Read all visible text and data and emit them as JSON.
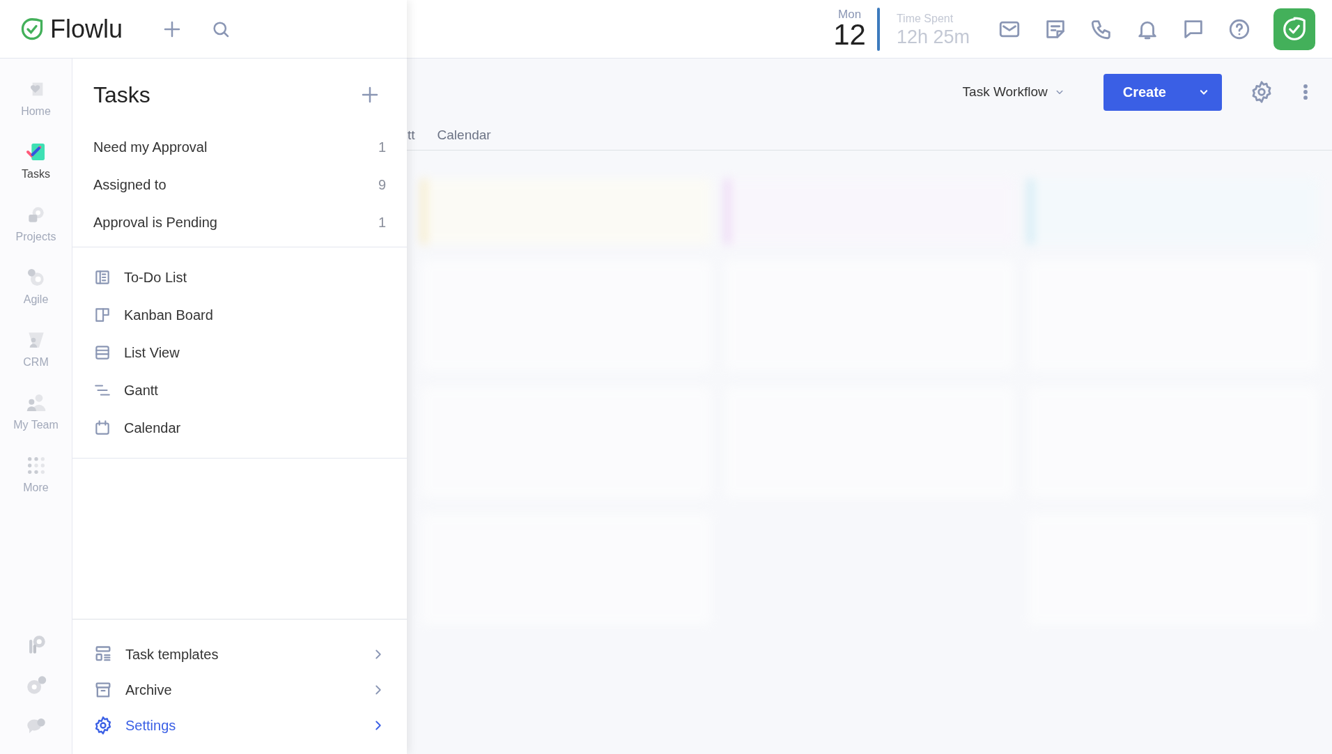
{
  "topbar": {
    "logo": "Flowlu",
    "date": {
      "weekday": "Mon",
      "day": "12"
    },
    "time_spent": {
      "label": "Time Spent",
      "value": "12h 25m"
    }
  },
  "rail": {
    "items": [
      {
        "label": "Home",
        "kind": "home",
        "selected": false
      },
      {
        "label": "Tasks",
        "kind": "tasks",
        "selected": true
      },
      {
        "label": "Projects",
        "kind": "projects",
        "selected": false
      },
      {
        "label": "Agile",
        "kind": "agile",
        "selected": false
      },
      {
        "label": "CRM",
        "kind": "crm",
        "selected": false
      },
      {
        "label": "My Team",
        "kind": "team",
        "selected": false
      },
      {
        "label": "More",
        "kind": "more",
        "selected": false
      }
    ]
  },
  "panel": {
    "title": "Tasks",
    "filters": [
      {
        "label": "Need my Approval",
        "count": "1"
      },
      {
        "label": "Assigned to",
        "count": "9"
      },
      {
        "label": "Approval is Pending",
        "count": "1"
      }
    ],
    "views": [
      {
        "label": "To-Do List",
        "kind": "todo"
      },
      {
        "label": "Kanban Board",
        "kind": "kanban"
      },
      {
        "label": "List View",
        "kind": "list"
      },
      {
        "label": "Gantt",
        "kind": "gantt"
      },
      {
        "label": "Calendar",
        "kind": "calendar"
      }
    ],
    "footer": [
      {
        "label": "Task templates",
        "kind": "templates",
        "selected": false
      },
      {
        "label": "Archive",
        "kind": "archive",
        "selected": false
      },
      {
        "label": "Settings",
        "kind": "settings",
        "selected": true
      }
    ]
  },
  "content": {
    "tabs": [
      {
        "label": "tt"
      },
      {
        "label": "Calendar"
      }
    ],
    "workflow": "Task Workflow",
    "create": "Create"
  }
}
